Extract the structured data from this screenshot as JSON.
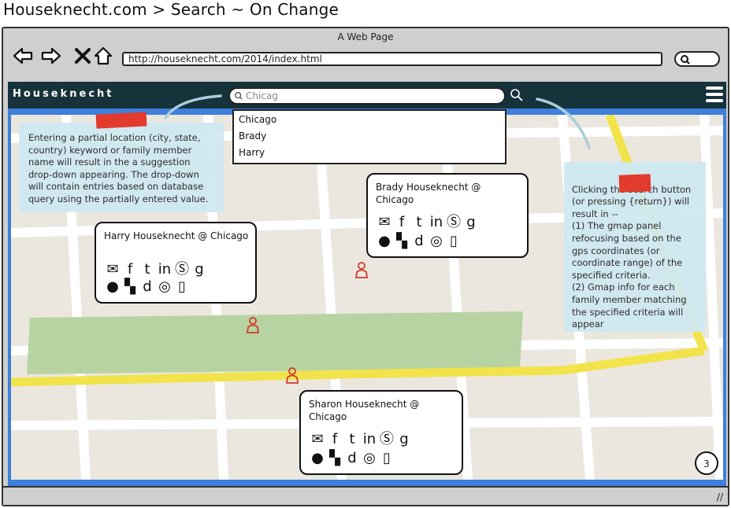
{
  "page_title": "Houseknecht.com > Search ~ On Change",
  "browser": {
    "window_title": "A Web Page",
    "url": "http://houseknecht.com/2014/index.html"
  },
  "app": {
    "brand": "Houseknecht",
    "search_value": "Chicag",
    "suggestions": [
      "Chicago",
      "Brady",
      "Harry"
    ]
  },
  "notes": {
    "left": "Entering a partial location (city, state, country) keyword or family member name will result in the a suggestion drop-down appearing.  The drop-down will contain entries based on database query using the partially entered value.",
    "right": "Clicking the search button (or pressing {return}) will result in --\n(1) The gmap panel refocusing based on the gps coordinates (or coordinate range) of the specified criteria.\n(2) Gmap info for each family member matching the specified criteria will appear"
  },
  "bubbles": [
    {
      "name": "Harry Houseknecht @ Chicago"
    },
    {
      "name": "Brady Houseknecht @ Chicago"
    },
    {
      "name": "Sharon Houseknecht @ Chicago"
    }
  ],
  "icons": [
    "email-icon",
    "facebook-icon",
    "twitter-icon",
    "linkedin-icon",
    "skype-icon",
    "google-icon",
    "flickr-icon",
    "delicious-icon",
    "digg-icon",
    "blogger-icon",
    "mobile-icon"
  ],
  "page_number": "3",
  "colors": {
    "app_bar": "#16323b",
    "viewport_border": "#3f7fdc",
    "note_bg": "#cfe9f1",
    "tape": "#e23a2c",
    "road_yellow": "#f2e34b",
    "park": "#b8d3a2"
  }
}
